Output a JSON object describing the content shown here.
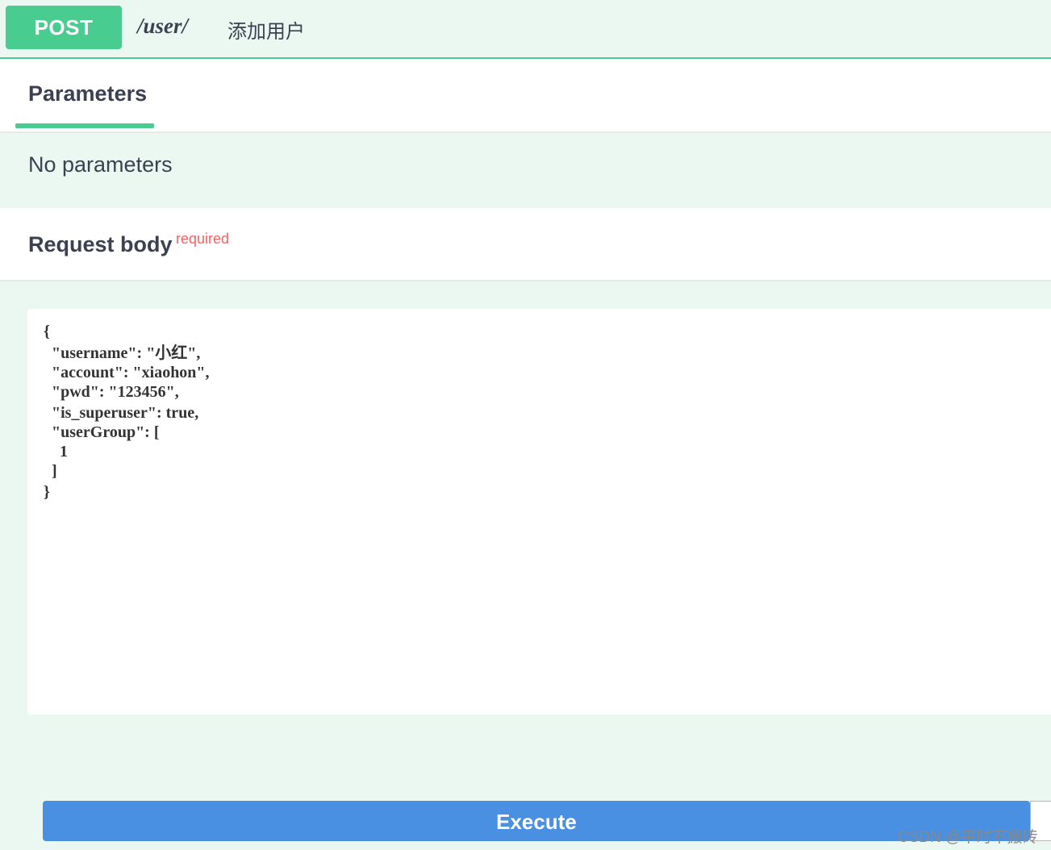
{
  "summary": {
    "method": "POST",
    "path": "/user/",
    "description": "添加用户"
  },
  "tabs": {
    "parameters": "Parameters"
  },
  "parameters": {
    "empty_text": "No parameters"
  },
  "request_body": {
    "title": "Request body",
    "required_label": "required",
    "lines": [
      "{",
      "  \"username\": \"小红\",",
      "  \"account\": \"xiaohon\",",
      "  \"pwd\": \"123456\",",
      "  \"is_superuser\": true,",
      "  \"userGroup\": [",
      "    1",
      "  ]",
      "}"
    ]
  },
  "actions": {
    "execute_label": "Execute"
  },
  "watermark": "CSDN @平时不搬砖",
  "colors": {
    "post_green": "#49cc90",
    "execute_blue": "#4990e2",
    "required_red": "#ff6060"
  }
}
